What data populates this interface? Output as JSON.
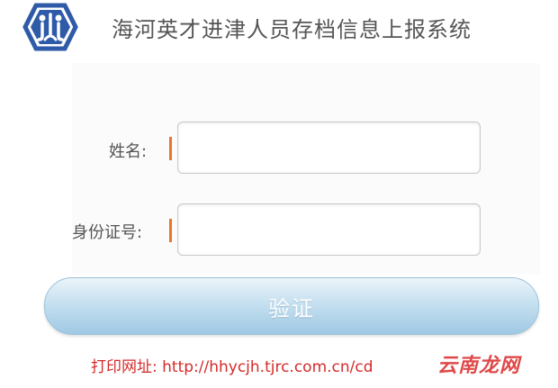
{
  "header": {
    "title": "海河英才进津人员存档信息上报系统"
  },
  "form": {
    "name_label": "姓名:",
    "id_label": "身份证号:",
    "name_value": "",
    "id_value": ""
  },
  "actions": {
    "verify_label": "验证"
  },
  "footer": {
    "print_address": "打印网址: http://hhycjh.tjrc.com.cn/cd"
  },
  "watermark": {
    "text": "云南龙网"
  },
  "colors": {
    "accent_marker": "#e8762c",
    "button_gradient_top": "#eaf4fa",
    "button_gradient_bottom": "#9fc9e3",
    "footer_text": "#d42a2a",
    "logo_blue": "#2f5aa8"
  },
  "icons": {
    "logo": "hexagon-emblem-icon"
  }
}
